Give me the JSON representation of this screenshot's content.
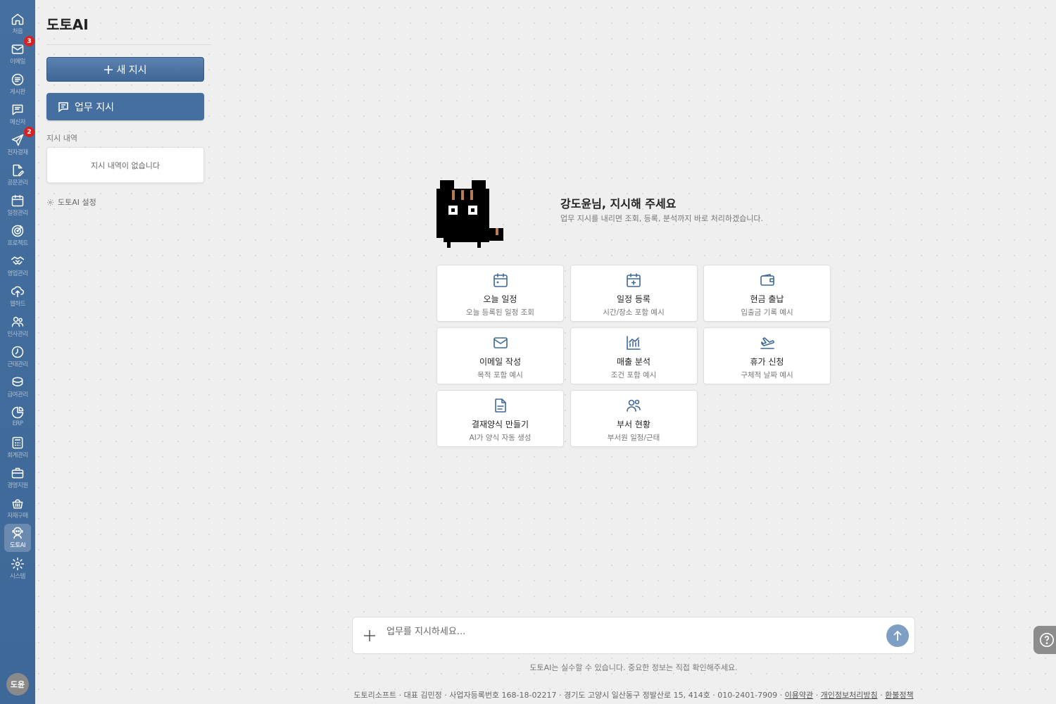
{
  "rail": {
    "items": [
      {
        "label": "처음",
        "icon": "home-icon"
      },
      {
        "label": "이메일",
        "icon": "mail-icon",
        "badge": "3"
      },
      {
        "label": "게시판",
        "icon": "board-icon"
      },
      {
        "label": "메신저",
        "icon": "messenger-icon"
      },
      {
        "label": "전자결재",
        "icon": "send-icon",
        "badge": "2"
      },
      {
        "label": "공문관리",
        "icon": "document-edit-icon"
      },
      {
        "label": "일정관리",
        "icon": "calendar-icon"
      },
      {
        "label": "프로젝트",
        "icon": "target-icon"
      },
      {
        "label": "영업관리",
        "icon": "handshake-icon"
      },
      {
        "label": "웹하드",
        "icon": "cloud-upload-icon"
      },
      {
        "label": "인사관리",
        "icon": "people-icon"
      },
      {
        "label": "근태관리",
        "icon": "clock-icon"
      },
      {
        "label": "급여관리",
        "icon": "coins-icon"
      },
      {
        "label": "ERP",
        "icon": "pie-chart-icon"
      },
      {
        "label": "회계관리",
        "icon": "calculator-icon"
      },
      {
        "label": "경영지원",
        "icon": "briefcase-icon"
      },
      {
        "label": "자재구매",
        "icon": "basket-icon"
      },
      {
        "label": "도토AI",
        "icon": "robot-icon",
        "active": true
      },
      {
        "label": "시스템",
        "icon": "gear-icon"
      }
    ],
    "avatar": "도윤"
  },
  "panel": {
    "title": "도토AI",
    "new_button": "새 지시",
    "task_button": "업무 지시",
    "history_label": "지시 내역",
    "history_empty": "지시 내역이 없습니다",
    "settings_link": "도토AI 설정"
  },
  "hero": {
    "title": "강도윤님, 지시해 주세요",
    "subtitle": "업무 지시를 내리면 조회, 등록, 분석까지 바로 처리하겠습니다."
  },
  "cards": [
    {
      "title": "오늘 일정",
      "sub": "오늘 등록된 일정 조회",
      "icon": "calendar-icon"
    },
    {
      "title": "일정 등록",
      "sub": "시간/장소 포함 예시",
      "icon": "calendar-plus-icon"
    },
    {
      "title": "현금 출납",
      "sub": "입출금 기록 예시",
      "icon": "wallet-icon"
    },
    {
      "title": "이메일 작성",
      "sub": "목적 포함 예시",
      "icon": "mail-icon"
    },
    {
      "title": "매출 분석",
      "sub": "조건 포함 예시",
      "icon": "chart-icon"
    },
    {
      "title": "휴가 신청",
      "sub": "구체적 날짜 예시",
      "icon": "plane-icon"
    },
    {
      "title": "결재양식 만들기",
      "sub": "AI가 양식 자동 생성",
      "icon": "file-icon"
    },
    {
      "title": "부서 현황",
      "sub": "부서원 일정/근태",
      "icon": "users-icon"
    }
  ],
  "composer": {
    "placeholder": "업무를 지시하세요...",
    "disclaimer": "도토AI는 실수할 수 있습니다. 중요한 정보는 직접 확인해주세요."
  },
  "footer": {
    "text": "도토리소프트 · 대표 김민정 · 사업자등록번호 168-18-02217 · 경기도 고양시 일산동구 정발산로 15, 414호 · 010-2401-7909 · ",
    "links": [
      "이용약관",
      "개인정보처리방침",
      "환불정책"
    ]
  },
  "colors": {
    "rail": "#456f9f",
    "accent": "#3e6897",
    "badge": "#d62222"
  }
}
